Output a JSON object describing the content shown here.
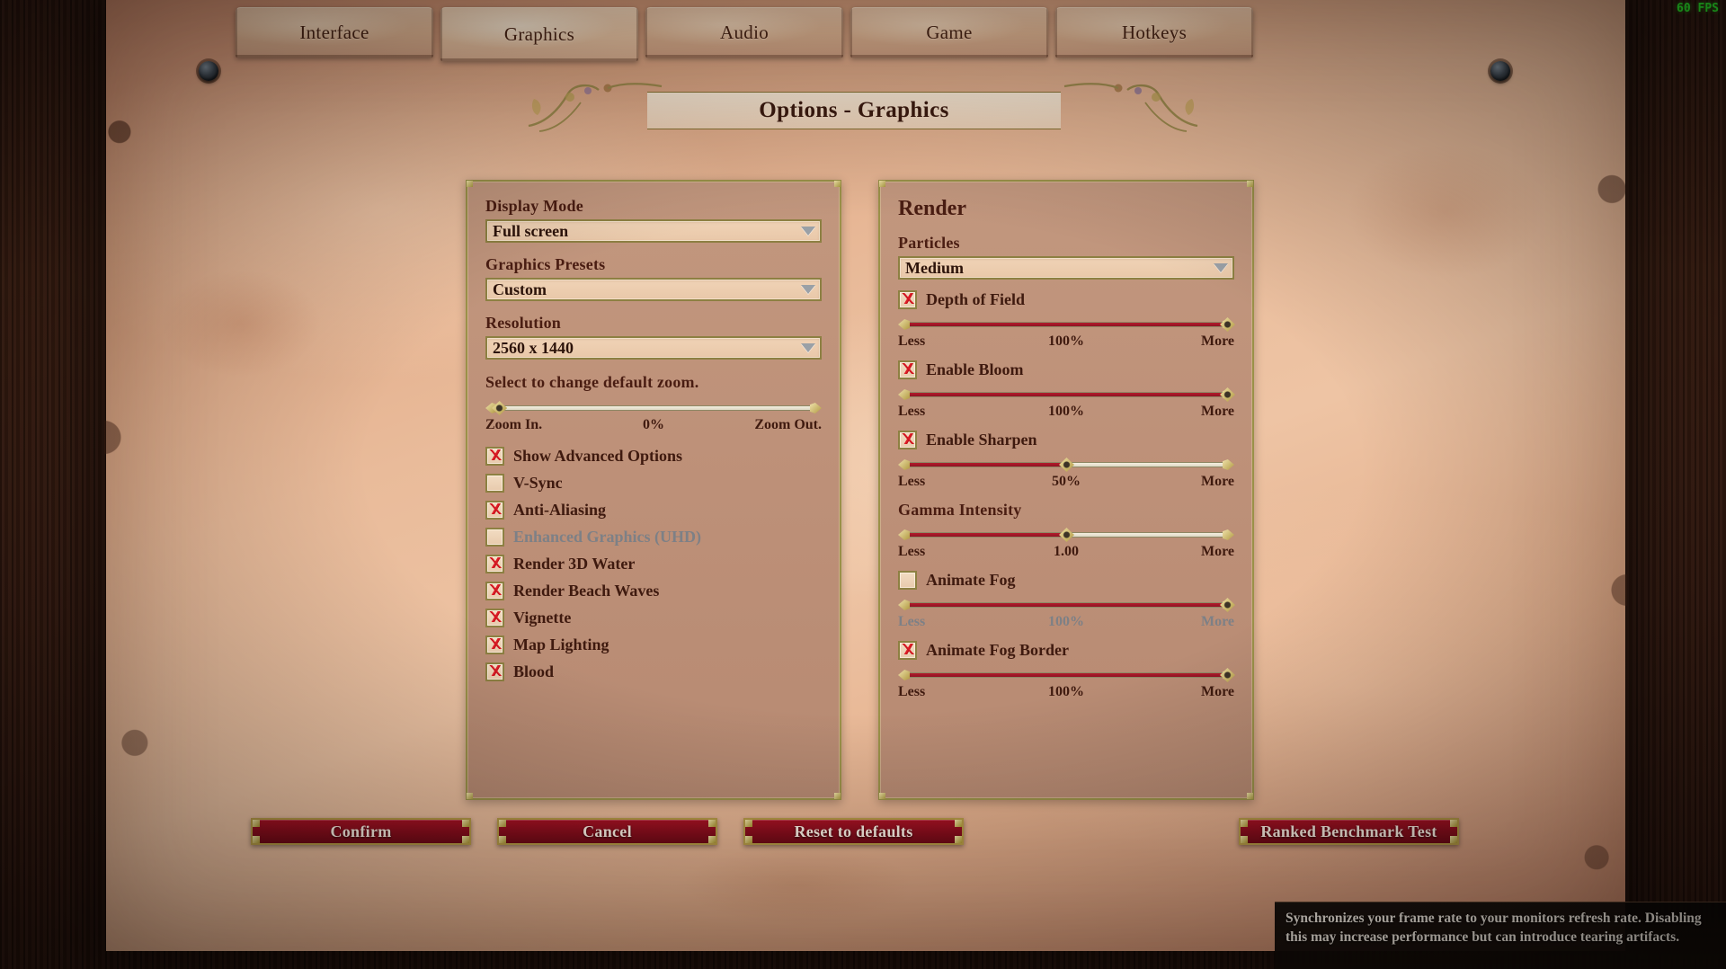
{
  "hud": {
    "fps": "60 FPS"
  },
  "tabs": [
    {
      "label": "Interface",
      "selected": false
    },
    {
      "label": "Graphics",
      "selected": true
    },
    {
      "label": "Audio",
      "selected": false
    },
    {
      "label": "Game",
      "selected": false
    },
    {
      "label": "Hotkeys",
      "selected": false
    }
  ],
  "title": "Options - Graphics",
  "left_panel": {
    "display_mode": {
      "label": "Display Mode",
      "value": "Full screen"
    },
    "graphics_presets": {
      "label": "Graphics Presets",
      "value": "Custom"
    },
    "resolution": {
      "label": "Resolution",
      "value": "2560 x 1440"
    },
    "zoom": {
      "label": "Select to change default zoom.",
      "left_label": "Zoom In.",
      "value_label": "0%",
      "right_label": "Zoom Out.",
      "percent": 2
    },
    "checkboxes": [
      {
        "label": "Show Advanced Options",
        "checked": true,
        "disabled": false
      },
      {
        "label": "V-Sync",
        "checked": false,
        "disabled": false
      },
      {
        "label": "Anti-Aliasing",
        "checked": true,
        "disabled": false
      },
      {
        "label": "Enhanced Graphics (UHD)",
        "checked": false,
        "disabled": true
      },
      {
        "label": "Render 3D Water",
        "checked": true,
        "disabled": false
      },
      {
        "label": "Render Beach Waves",
        "checked": true,
        "disabled": false
      },
      {
        "label": "Vignette",
        "checked": true,
        "disabled": false
      },
      {
        "label": "Map Lighting",
        "checked": true,
        "disabled": false
      },
      {
        "label": "Blood",
        "checked": true,
        "disabled": false
      }
    ]
  },
  "right_panel": {
    "title": "Render",
    "particles": {
      "label": "Particles",
      "value": "Medium"
    },
    "items": [
      {
        "kind": "checkbox",
        "label": "Depth of Field",
        "checked": true,
        "disabled": false,
        "slider": {
          "left_label": "Less",
          "value_label": "100%",
          "right_label": "More",
          "percent": 100,
          "disabled": false
        }
      },
      {
        "kind": "checkbox",
        "label": "Enable Bloom",
        "checked": true,
        "disabled": false,
        "slider": {
          "left_label": "Less",
          "value_label": "100%",
          "right_label": "More",
          "percent": 100,
          "disabled": false
        }
      },
      {
        "kind": "checkbox",
        "label": "Enable Sharpen",
        "checked": true,
        "disabled": false,
        "slider": {
          "left_label": "Less",
          "value_label": "50%",
          "right_label": "More",
          "percent": 50,
          "disabled": false
        }
      },
      {
        "kind": "label",
        "label": "Gamma Intensity",
        "slider": {
          "left_label": "Less",
          "value_label": "1.00",
          "right_label": "More",
          "percent": 50,
          "disabled": false
        }
      },
      {
        "kind": "checkbox",
        "label": "Animate Fog",
        "checked": false,
        "disabled": false,
        "slider": {
          "left_label": "Less",
          "value_label": "100%",
          "right_label": "More",
          "percent": 100,
          "disabled": true
        }
      },
      {
        "kind": "checkbox",
        "label": "Animate Fog Border",
        "checked": true,
        "disabled": false,
        "slider": {
          "left_label": "Less",
          "value_label": "100%",
          "right_label": "More",
          "percent": 100,
          "disabled": false
        }
      }
    ]
  },
  "buttons": [
    {
      "label": "Confirm",
      "name": "confirm-button"
    },
    {
      "label": "Cancel",
      "name": "cancel-button"
    },
    {
      "label": "Reset to defaults",
      "name": "reset-to-defaults-button"
    },
    {
      "label": "Ranked Benchmark Test",
      "name": "ranked-benchmark-test-button"
    }
  ],
  "tooltip": {
    "text": "Synchronizes your frame rate to your monitors refresh rate. Disabling this may increase performance but can introduce tearing artifacts."
  },
  "colors": {
    "parchment": "#e4b694",
    "panel_bg": "#bd9078",
    "panel_border": "#9a9148",
    "accent_red": "#8d0e1d",
    "slider_fill": "#b41b2c",
    "check_red": "#d2161f",
    "disabled_text": "#7d8086",
    "fps_green": "#2bf12b"
  }
}
